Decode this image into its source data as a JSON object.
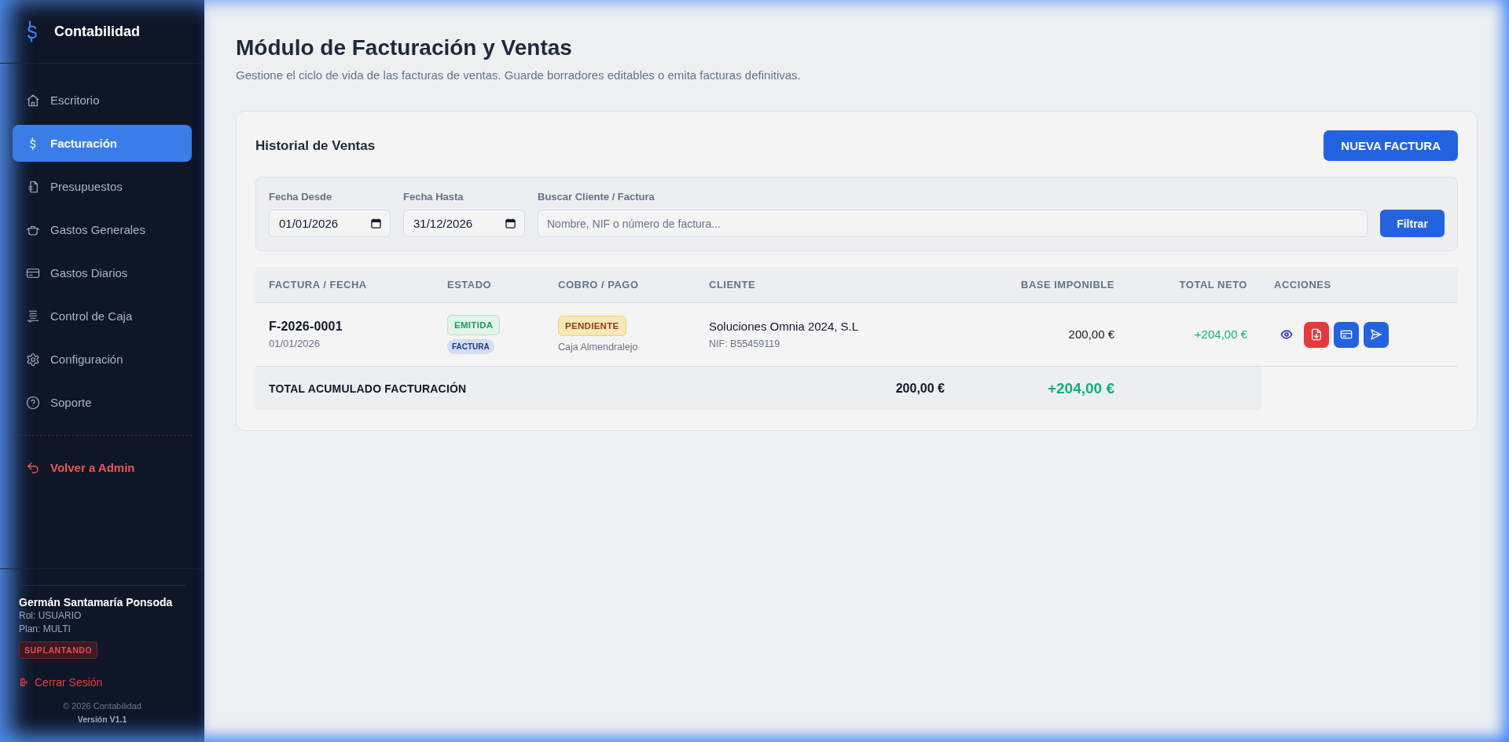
{
  "sidebar": {
    "brand": "Contabilidad",
    "nav_items": [
      {
        "label": "Escritorio",
        "selected": false
      },
      {
        "label": "Facturación",
        "selected": true
      },
      {
        "label": "Presupuestos",
        "selected": false
      },
      {
        "label": "Gastos Generales",
        "selected": false
      },
      {
        "label": "Gastos Diarios",
        "selected": false
      },
      {
        "label": "Control de Caja",
        "selected": false
      },
      {
        "label": "Configuración",
        "selected": false
      },
      {
        "label": "Soporte",
        "selected": false
      }
    ],
    "back_link": "Volver a Admin",
    "user": {
      "name": "Germán Santamaría Ponsoda",
      "role": "Rol: USUARIO",
      "plan": "Plan: MULTI",
      "badge": "SUPLANTANDO"
    },
    "logout": "Cerrar Sesión",
    "copyright": "© 2026 Contabilidad",
    "version": "Versión V1.1"
  },
  "header": {
    "title": "Módulo de Facturación y Ventas",
    "subtitle": "Gestione el ciclo de vida de las facturas de ventas. Guarde borradores editables o emita facturas definitivas."
  },
  "card": {
    "title": "Historial de Ventas",
    "new_button": "NUEVA FACTURA",
    "filters": {
      "date_from": {
        "label": "Fecha Desde",
        "value": "01/01/2026"
      },
      "date_to": {
        "label": "Fecha Hasta",
        "value": "31/12/2026"
      },
      "search": {
        "label": "Buscar Cliente / Factura",
        "placeholder": "Nombre, NIF o número de factura..."
      },
      "button": "Filtrar"
    },
    "table": {
      "columns": [
        "FACTURA / FECHA",
        "ESTADO",
        "COBRO / PAGO",
        "CLIENTE",
        "BASE IMPONIBLE",
        "TOTAL NETO",
        "ACCIONES"
      ],
      "rows": [
        {
          "invoice": "F-2026-0001",
          "date": "01/01/2026",
          "status": "EMITIDA",
          "type": "FACTURA",
          "payment": "PENDIENTE",
          "account": "Caja Almendralejo",
          "client": "Soluciones Omnia 2024, S.L",
          "nif": "NIF: B55459119",
          "base": "200,00 €",
          "total": "+204,00 €"
        }
      ],
      "totals": {
        "label": "TOTAL ACUMULADO FACTURACIÓN",
        "base": "200,00 €",
        "total": "+204,00 €"
      }
    }
  }
}
